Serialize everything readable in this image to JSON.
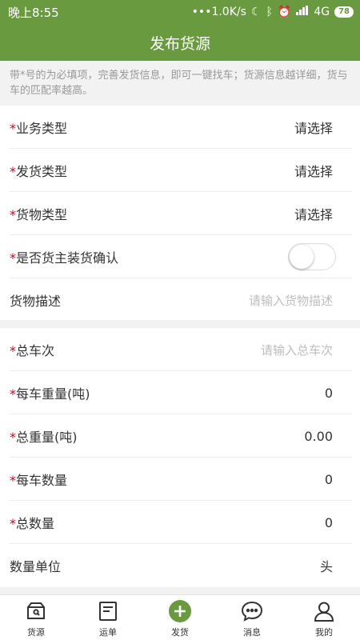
{
  "status": {
    "time": "晚上8:55",
    "speed": "•••1.0K/s",
    "network": "4G",
    "battery": "78"
  },
  "header": {
    "title": "发布货源"
  },
  "notice": "带*号的为必填项，完善发货信息，即可一键找车；货源信息越详细，货与车的匹配率越高。",
  "form": {
    "required_mark": "*",
    "business_type": {
      "label": "业务类型",
      "value": "请选择"
    },
    "shipping_type": {
      "label": "发货类型",
      "value": "请选择"
    },
    "cargo_type": {
      "label": "货物类型",
      "value": "请选择"
    },
    "owner_confirm": {
      "label": "是否货主装货确认",
      "enabled": false
    },
    "cargo_desc": {
      "label": "货物描述",
      "placeholder": "请输入货物描述"
    },
    "total_trips": {
      "label": "总车次",
      "placeholder": "请输入总车次"
    },
    "weight_per_truck": {
      "label": "每车重量(吨)",
      "value": "0"
    },
    "total_weight": {
      "label": "总重量(吨)",
      "value": "0.00"
    },
    "qty_per_truck": {
      "label": "每车数量",
      "value": "0"
    },
    "total_qty": {
      "label": "总数量",
      "value": "0"
    },
    "qty_unit": {
      "label": "数量单位",
      "value": "头"
    }
  },
  "tabs": {
    "source": {
      "label": "货源",
      "icon": "box-icon"
    },
    "waybill": {
      "label": "运单",
      "icon": "document-icon"
    },
    "ship": {
      "label": "发货",
      "icon": "plus-circle-icon"
    },
    "message": {
      "label": "消息",
      "icon": "chat-icon"
    },
    "mine": {
      "label": "我的",
      "icon": "user-icon"
    }
  },
  "colors": {
    "brand": "#6a9a40",
    "required": "#d0021b"
  }
}
